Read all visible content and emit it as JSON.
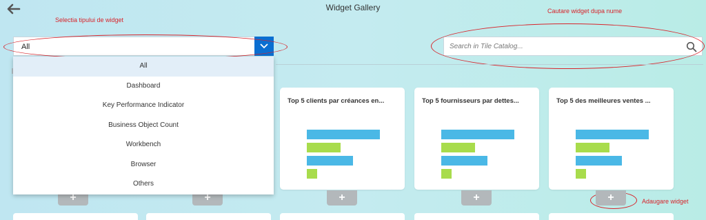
{
  "header": {
    "title": "Widget Gallery"
  },
  "annotations": {
    "type_select": "Selectia tipului de widget",
    "search": "Cautare widget dupa nume",
    "add": "Adaugare widget"
  },
  "type_select": {
    "value": "All",
    "options": [
      "All",
      "Dashboard",
      "Key Performance Indicator",
      "Business Object Count",
      "Workbench",
      "Browser",
      "Others"
    ]
  },
  "search": {
    "placeholder": "Search in Tile Catalog..."
  },
  "tiles": [
    {
      "title": "Top 5 clients par créances en...",
      "bars": [
        0.95,
        0.44,
        0.6,
        0.13
      ]
    },
    {
      "title": "Top 5 fournisseurs par dettes...",
      "bars": [
        0.95,
        0.44,
        0.6,
        0.13
      ]
    },
    {
      "title": "Top 5 des meilleures ventes ...",
      "bars": [
        0.95,
        0.44,
        0.6,
        0.13
      ]
    }
  ],
  "add_label": "+",
  "colors": {
    "accent": "#0a6ed1",
    "annotation": "#d8232a",
    "bar_blue": "#4ab8e6",
    "bar_green": "#a8dc4c"
  }
}
